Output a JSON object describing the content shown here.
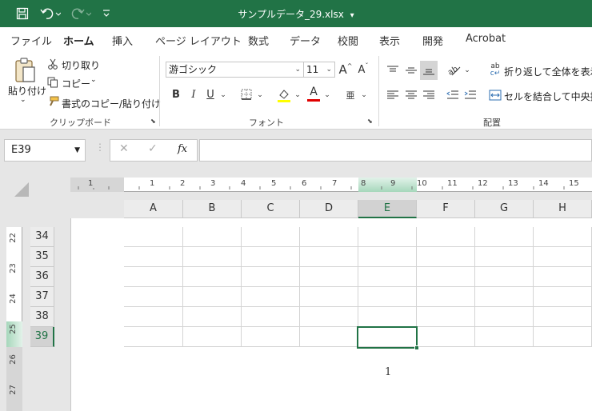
{
  "window": {
    "title": "サンプルデータ_29.xlsx",
    "title_dropdown": "▾",
    "accent_color": "#217346"
  },
  "quick_access": {
    "save_icon": "save-icon",
    "undo_icon": "undo-icon",
    "redo_icon": "redo-icon",
    "customize_icon": "customize-icon"
  },
  "menu": {
    "tabs": [
      "ファイル",
      "ホーム",
      "挿入",
      "ページ レイアウト",
      "数式",
      "データ",
      "校閲",
      "表示",
      "開発",
      "Acrobat"
    ],
    "active": "ホーム"
  },
  "ribbon": {
    "clipboard": {
      "paste_label": "貼り付け",
      "cut_label": "切り取り",
      "copy_label": "コピー",
      "format_painter_label": "書式のコピー/貼り付け",
      "group_label": "クリップボード"
    },
    "font": {
      "font_name": "游ゴシック",
      "font_size": "11",
      "grow_label": "A",
      "shrink_label": "A",
      "bold": "B",
      "italic": "I",
      "underline": "U",
      "font_color_letter": "A",
      "phonetic": "亜",
      "group_label": "フォント",
      "highlight_color": "#ffff00",
      "font_color": "#e00000"
    },
    "alignment": {
      "wrap_text_label": "折り返して全体を表示する",
      "merge_center_label": "セルを結合して中央揃え",
      "group_label": "配置"
    }
  },
  "formula_bar": {
    "name_box": "E39",
    "cancel_icon": "✕",
    "enter_icon": "✓",
    "fx_label": "fx",
    "formula": ""
  },
  "sheet": {
    "columns": [
      "A",
      "B",
      "C",
      "D",
      "E",
      "F",
      "G",
      "H"
    ],
    "rows": [
      "34",
      "35",
      "36",
      "37",
      "38",
      "39"
    ],
    "selected_cell": "E39",
    "ruler_h": [
      "1",
      "1",
      "2",
      "3",
      "4",
      "5",
      "6",
      "7",
      "8",
      "9",
      "10",
      "11",
      "12",
      "13",
      "14",
      "15"
    ],
    "ruler_v": [
      "22",
      "23",
      "24",
      "25",
      "26",
      "27"
    ],
    "page_number": "1"
  }
}
